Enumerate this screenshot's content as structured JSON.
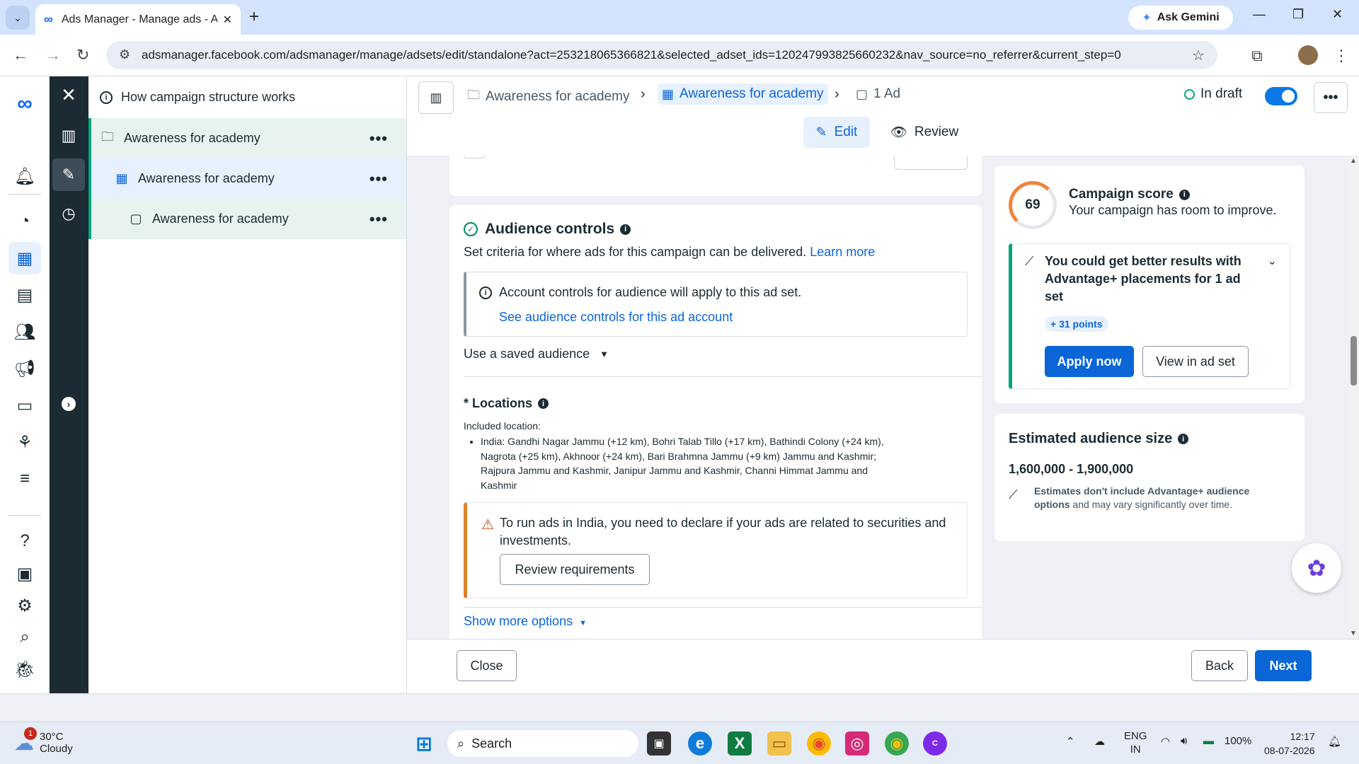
{
  "browser": {
    "tab_title": "Ads Manager - Manage ads - A",
    "ask_gemini": "Ask Gemini",
    "url": "adsmanager.facebook.com/adsmanager/manage/adsets/edit/standalone?act=253218065366821&selected_adset_ids=120247993825660232&nav_source=no_referrer&current_step=0"
  },
  "structure": {
    "header": "How campaign structure works",
    "items": [
      {
        "label": "Awareness for academy",
        "level": "campaign"
      },
      {
        "label": "Awareness for academy",
        "level": "adset"
      },
      {
        "label": "Awareness for academy",
        "level": "ad"
      }
    ],
    "more": "•••"
  },
  "topbar": {
    "crumbs": [
      "Awareness for academy",
      "Awareness for academy",
      "1 Ad"
    ],
    "status": "In draft",
    "more": "•••",
    "edit": "Edit",
    "review": "Review"
  },
  "audience": {
    "title": "Audience controls",
    "subtitle": "Set criteria for where ads for this campaign can be delivered.",
    "learn_more": "Learn more",
    "notice_text": "Account controls for audience will apply to this ad set.",
    "notice_link": "See audience controls for this ad account",
    "saved_audience": "Use a saved audience",
    "locations_title": "* Locations",
    "included_label": "Included location:",
    "locations_text": "India: Gandhi Nagar Jammu (+12 km), Bohri Talab Tillo (+17 km), Bathindi Colony (+24 km), Nagrota (+25 km), Akhnoor (+24 km), Bari Brahmna Jammu (+9 km) Jammu and Kashmir; Rajpura Jammu and Kashmir, Janipur Jammu and Kashmir, Channi Himmat Jammu and Kashmir",
    "warning_text": "To run ads in India, you need to declare if your ads are related to securities and investments.",
    "warning_button": "Review requirements",
    "show_more": "Show more options"
  },
  "score": {
    "value": "69",
    "title": "Campaign score",
    "subtitle": "Your campaign has room to improve.",
    "rec_text": "You could get better results with Advantage+ placements for 1 ad set",
    "points": "+ 31 points",
    "apply": "Apply now",
    "view": "View in ad set"
  },
  "audience_size": {
    "title": "Estimated audience size",
    "value": "1,600,000 - 1,900,000",
    "note_bold": "Estimates don't include Advantage+ audience options",
    "note_rest": " and may vary significantly over time."
  },
  "footer": {
    "close": "Close",
    "back": "Back",
    "next": "Next"
  },
  "taskbar": {
    "temp": "30°C",
    "weather": "Cloudy",
    "weather_badge": "1",
    "search": "Search",
    "lang1": "ENG",
    "lang2": "IN",
    "battery": "100%",
    "time": "12:17",
    "date": "08-07-2026"
  },
  "colors": {
    "accent": "#0a66d6",
    "success": "#00a67e",
    "warning": "#e0822b",
    "dark_strip": "#1c2b33"
  }
}
